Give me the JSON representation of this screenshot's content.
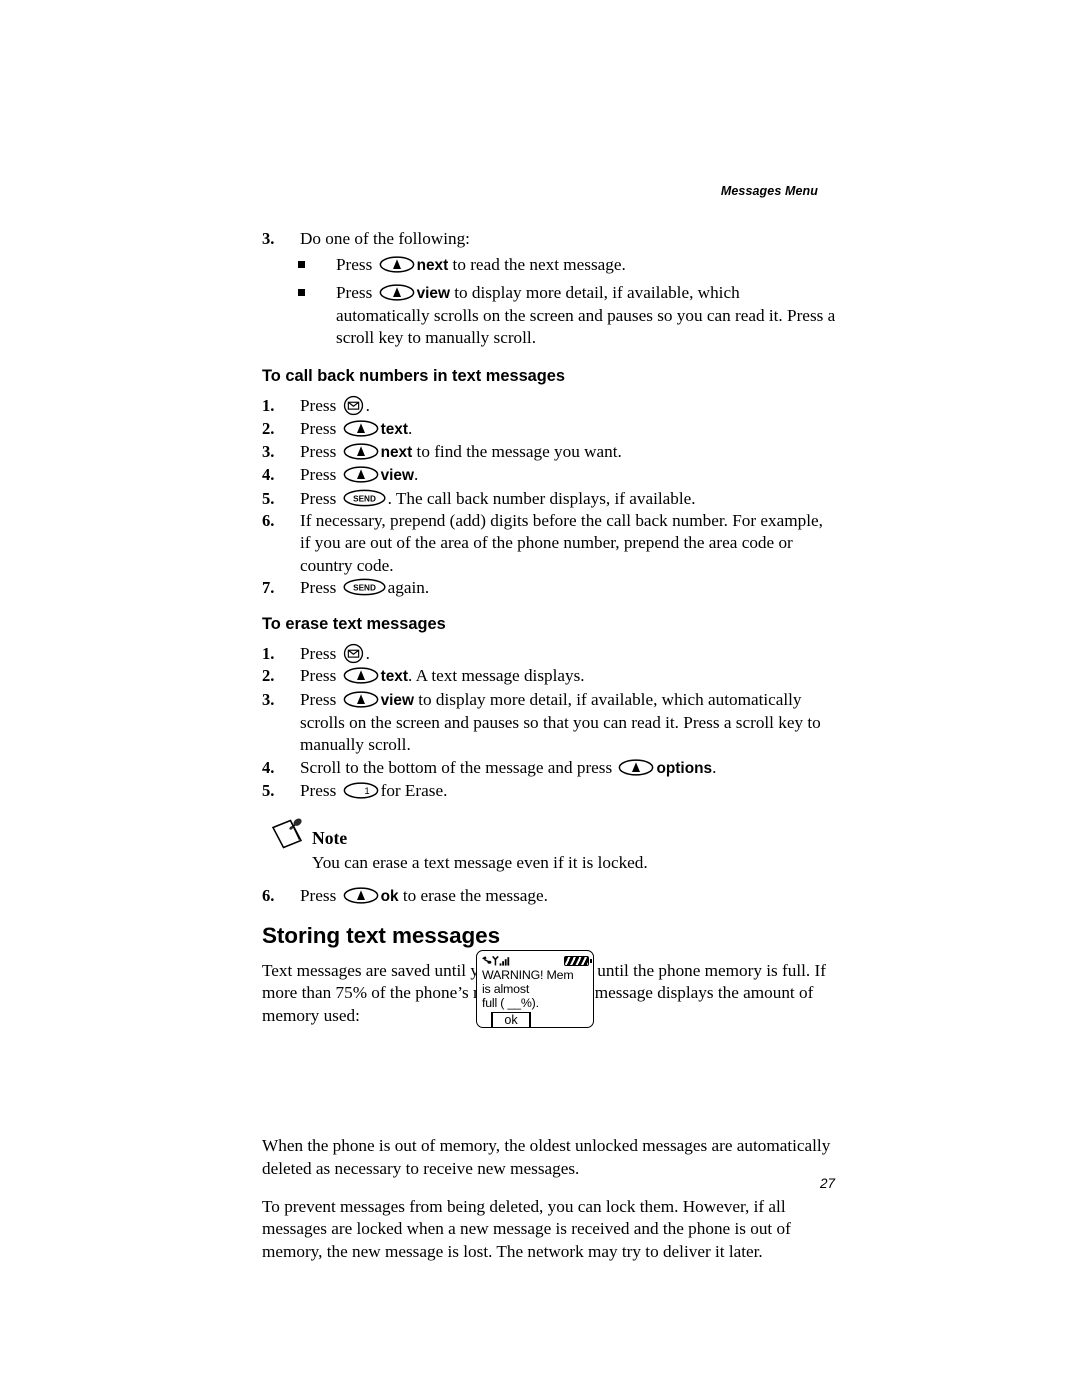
{
  "header": {
    "running_head": "Messages Menu"
  },
  "folio": {
    "page_number": "27"
  },
  "icons": {
    "soft_key": "soft-key-oval-up-arrow",
    "message_key": "message-envelope-key",
    "send_key_label": "SEND",
    "one_key_label": "1",
    "note": "note-pushpin-icon"
  },
  "steps_top": {
    "step3": {
      "num": "3.",
      "text": "Do one of the following:"
    },
    "bullets": [
      {
        "pre": "Press",
        "bold": "next",
        "post": "to read the next message."
      },
      {
        "pre": "Press",
        "bold": "view",
        "post": "to display more detail, if available, which automatically scrolls on the screen and pauses so you can read it. Press a scroll key to manually scroll."
      }
    ]
  },
  "section_callback": {
    "heading": "To call back numbers in text messages",
    "steps": [
      {
        "num": "1.",
        "pre": "Press",
        "key": "envelope",
        "bold": "",
        "post": "."
      },
      {
        "num": "2.",
        "pre": "Press",
        "key": "soft",
        "bold": "text",
        "post": "."
      },
      {
        "num": "3.",
        "pre": "Press",
        "key": "soft",
        "bold": "next",
        "post": "to find the message you want."
      },
      {
        "num": "4.",
        "pre": "Press",
        "key": "soft",
        "bold": "view",
        "post": "."
      },
      {
        "num": "5.",
        "pre": "Press",
        "key": "send",
        "bold": "",
        "post": ". The call back number displays, if available."
      },
      {
        "num": "6.",
        "pre": "",
        "key": "none",
        "bold": "",
        "post": "If necessary, prepend (add) digits before the call back number. For example, if you are out of the area of the phone number, prepend the area code or country code."
      },
      {
        "num": "7.",
        "pre": "Press",
        "key": "send",
        "bold": "",
        "post": "again."
      }
    ]
  },
  "section_erase": {
    "heading": "To erase text messages",
    "steps": [
      {
        "num": "1.",
        "pre": "Press",
        "key": "envelope",
        "bold": "",
        "post": "."
      },
      {
        "num": "2.",
        "pre": "Press",
        "key": "soft",
        "bold": "text",
        "post": ". A text message displays."
      },
      {
        "num": "3.",
        "pre": "Press",
        "key": "soft",
        "bold": "view",
        "post": "to display more detail, if available, which automatically scrolls on the screen and pauses so that you can read it. Press a scroll key to manually scroll."
      },
      {
        "num": "4.",
        "pre": "Scroll to the bottom of the message and press",
        "key": "soft",
        "bold": "options",
        "post": "."
      },
      {
        "num": "5.",
        "pre": "Press",
        "key": "one",
        "bold": "",
        "post": "for Erase."
      }
    ],
    "note": {
      "label": "Note",
      "body": "You can erase a text message even if it is locked."
    },
    "step6": {
      "num": "6.",
      "pre": "Press",
      "key": "soft",
      "bold": "ok",
      "post": "to erase the message."
    }
  },
  "section_storing": {
    "heading": "Storing text messages",
    "para1": "Text messages are saved until you erase them or until the phone memory is full. If more than 75% of the phone’s memory is full, a message displays the amount of memory used:",
    "para2": "When the phone is out of memory, the oldest unlocked messages are automatically deleted as necessary to receive new messages.",
    "para3": "To prevent messages from being deleted, you can lock them. However, if all messages are locked when a new message is received and the phone is out of memory, the new message is lost. The network may try to deliver it later."
  },
  "phone_screen": {
    "line1": "WARNING! Mem",
    "line2": "is almost",
    "line3": "full ( __%).",
    "ok_label": "ok"
  }
}
